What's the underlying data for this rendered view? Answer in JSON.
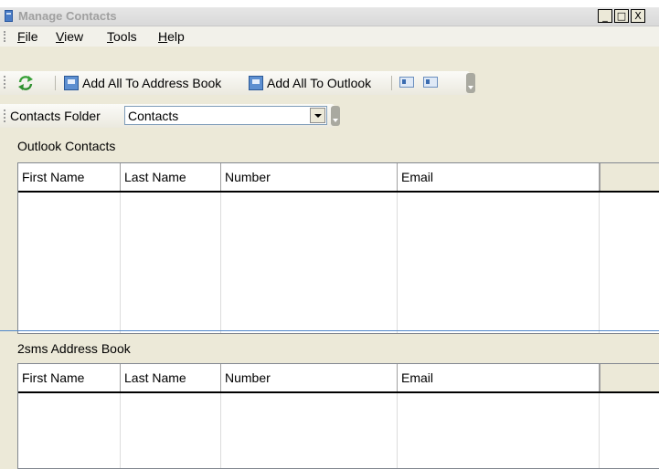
{
  "window": {
    "title": "Manage Contacts",
    "controls": [
      "_",
      "□",
      "X"
    ]
  },
  "menu": {
    "items": [
      {
        "accel": "F",
        "rest": "ile"
      },
      {
        "accel": "V",
        "rest": "iew"
      },
      {
        "accel": "T",
        "rest": "ools"
      },
      {
        "accel": "H",
        "rest": "elp"
      }
    ]
  },
  "toolbar": {
    "refresh_icon": "refresh-icon",
    "add_all_address_book": "Add All To Address Book",
    "add_all_outlook": "Add All To Outlook"
  },
  "folder_bar": {
    "label": "Contacts Folder",
    "selected": "Contacts"
  },
  "outlook_panel": {
    "title": "Outlook Contacts",
    "columns": [
      "First Name",
      "Last Name",
      "Number",
      "Email"
    ],
    "rows": []
  },
  "address_book_panel": {
    "title": "2sms Address Book",
    "columns": [
      "First Name",
      "Last Name",
      "Number",
      "Email"
    ],
    "rows": []
  },
  "colors": {
    "title_inactive": "#a0a0a0",
    "splitter": "#4f86c9",
    "face": "#ece9d8"
  }
}
